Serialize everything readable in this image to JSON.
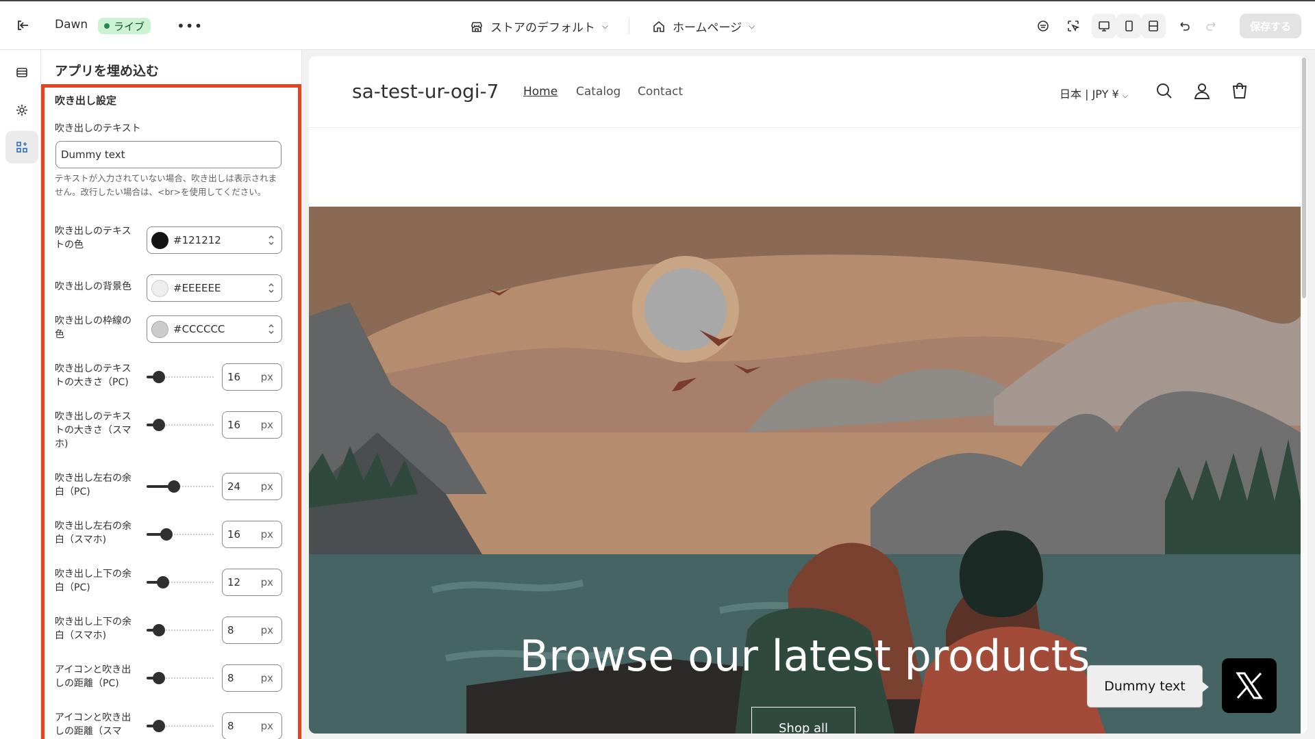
{
  "topbar": {
    "theme_name": "Dawn",
    "status": "ライブ",
    "store_selector": "ストアのデフォルト",
    "page_selector": "ホームページ",
    "save_label": "保存する"
  },
  "panel": {
    "title": "アプリを埋め込む",
    "section_title": "吹き出し設定",
    "text_label": "吹き出しのテキスト",
    "text_value": "Dummy text",
    "text_help": "テキストが入力されていない場合、吹き出しは表示されません。改行したい場合は、<br>を使用してください。",
    "colors": [
      {
        "label": "吹き出しのテキストの色",
        "value": "#121212",
        "swatch": "#121212"
      },
      {
        "label": "吹き出しの背景色",
        "value": "#EEEEEE",
        "swatch": "#EEEEEE"
      },
      {
        "label": "吹き出しの枠線の色",
        "value": "#CCCCCC",
        "swatch": "#CCCCCC"
      }
    ],
    "ranges": [
      {
        "label": "吹き出しのテキストの大きさ（PC)",
        "value": "16",
        "unit": "px"
      },
      {
        "label": "吹き出しのテキストの大きさ（スマホ)",
        "value": "16",
        "unit": "px"
      },
      {
        "label": "吹き出し左右の余白（PC)",
        "value": "24",
        "unit": "px"
      },
      {
        "label": "吹き出し左右の余白（スマホ)",
        "value": "16",
        "unit": "px"
      },
      {
        "label": "吹き出し上下の余白（PC)",
        "value": "12",
        "unit": "px"
      },
      {
        "label": "吹き出し上下の余白（スマホ)",
        "value": "8",
        "unit": "px"
      },
      {
        "label": "アイコンと吹き出しの距離（PC)",
        "value": "8",
        "unit": "px"
      },
      {
        "label": "アイコンと吹き出しの距離（スマ",
        "value": "8",
        "unit": "px"
      }
    ]
  },
  "store": {
    "name": "sa-test-ur-ogi-7",
    "nav": [
      "Home",
      "Catalog",
      "Contact"
    ],
    "currency": "日本 | JPY ¥",
    "hero_title": "Browse our latest products",
    "hero_button": "Shop all",
    "bubble_text": "Dummy text"
  },
  "accent": "#e8431f"
}
